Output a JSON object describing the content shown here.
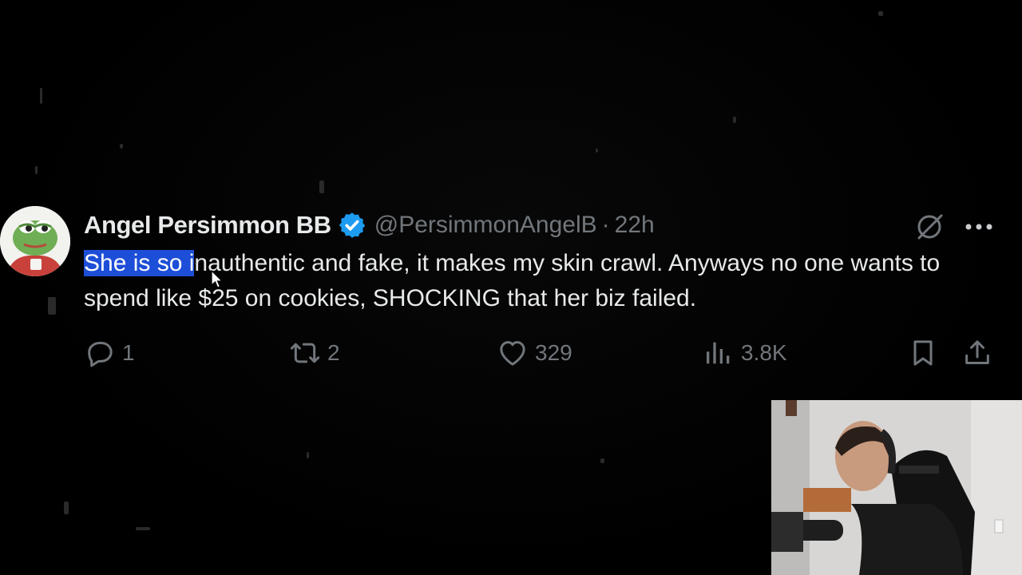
{
  "tweet": {
    "display_name": "Angel Persimmon BB",
    "handle": "@PersimmonAngelB",
    "separator": "·",
    "time": "22h",
    "text_selected": "She is so i",
    "text_rest": "nauthentic and fake, it makes my skin crawl. Anyways no one wants to spend like $25 on cookies, SHOCKING that her biz failed.",
    "verified_icon": "verified-badge-icon",
    "colors": {
      "name": "#e7e9ea",
      "muted": "#71767b",
      "verified": "#1d9bf0",
      "selection": "#1d4ed8"
    }
  },
  "actions": {
    "replies": "1",
    "reposts": "2",
    "likes": "329",
    "views": "3.8K"
  },
  "icons": {
    "grok": "grok-icon",
    "more": "more-dots-icon",
    "reply": "reply-bubble-icon",
    "repost": "repost-arrows-icon",
    "like": "heart-icon",
    "views": "bar-chart-icon",
    "bookmark": "bookmark-icon",
    "share": "share-upload-icon"
  }
}
